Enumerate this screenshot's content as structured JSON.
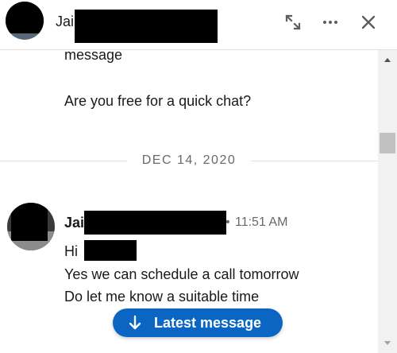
{
  "header": {
    "name_prefix": "Jai",
    "icons": {
      "expand": "expand-icon",
      "more": "more-options-icon",
      "close": "close-icon"
    }
  },
  "conversation": {
    "earlier_message_tail": "message",
    "earlier_message_question": "Are you free for a quick chat?",
    "date_divider": "DEC 14, 2020",
    "latest_group": {
      "sender_prefix": "Jai",
      "time_separator": "•",
      "time": "11:51 AM",
      "lines": [
        "Hi",
        "Yes we can schedule a call tomorrow",
        "Do let me know a suitable time"
      ]
    }
  },
  "latest_message_button": {
    "label": "Latest message",
    "icon": "arrow-down-icon"
  },
  "colors": {
    "accent": "#0a66c2",
    "scrollbar_thumb": "#c1c1c1"
  }
}
